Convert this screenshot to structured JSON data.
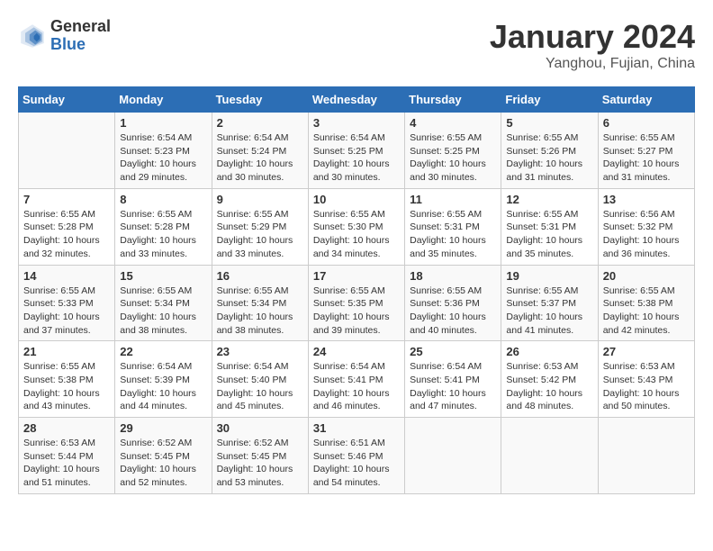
{
  "header": {
    "logo_line1": "General",
    "logo_line2": "Blue",
    "month_title": "January 2024",
    "location": "Yanghou, Fujian, China"
  },
  "calendar": {
    "days_of_week": [
      "Sunday",
      "Monday",
      "Tuesday",
      "Wednesday",
      "Thursday",
      "Friday",
      "Saturday"
    ],
    "weeks": [
      [
        {
          "day": "",
          "info": ""
        },
        {
          "day": "1",
          "info": "Sunrise: 6:54 AM\nSunset: 5:23 PM\nDaylight: 10 hours\nand 29 minutes."
        },
        {
          "day": "2",
          "info": "Sunrise: 6:54 AM\nSunset: 5:24 PM\nDaylight: 10 hours\nand 30 minutes."
        },
        {
          "day": "3",
          "info": "Sunrise: 6:54 AM\nSunset: 5:25 PM\nDaylight: 10 hours\nand 30 minutes."
        },
        {
          "day": "4",
          "info": "Sunrise: 6:55 AM\nSunset: 5:25 PM\nDaylight: 10 hours\nand 30 minutes."
        },
        {
          "day": "5",
          "info": "Sunrise: 6:55 AM\nSunset: 5:26 PM\nDaylight: 10 hours\nand 31 minutes."
        },
        {
          "day": "6",
          "info": "Sunrise: 6:55 AM\nSunset: 5:27 PM\nDaylight: 10 hours\nand 31 minutes."
        }
      ],
      [
        {
          "day": "7",
          "info": "Sunrise: 6:55 AM\nSunset: 5:28 PM\nDaylight: 10 hours\nand 32 minutes."
        },
        {
          "day": "8",
          "info": "Sunrise: 6:55 AM\nSunset: 5:28 PM\nDaylight: 10 hours\nand 33 minutes."
        },
        {
          "day": "9",
          "info": "Sunrise: 6:55 AM\nSunset: 5:29 PM\nDaylight: 10 hours\nand 33 minutes."
        },
        {
          "day": "10",
          "info": "Sunrise: 6:55 AM\nSunset: 5:30 PM\nDaylight: 10 hours\nand 34 minutes."
        },
        {
          "day": "11",
          "info": "Sunrise: 6:55 AM\nSunset: 5:31 PM\nDaylight: 10 hours\nand 35 minutes."
        },
        {
          "day": "12",
          "info": "Sunrise: 6:55 AM\nSunset: 5:31 PM\nDaylight: 10 hours\nand 35 minutes."
        },
        {
          "day": "13",
          "info": "Sunrise: 6:56 AM\nSunset: 5:32 PM\nDaylight: 10 hours\nand 36 minutes."
        }
      ],
      [
        {
          "day": "14",
          "info": "Sunrise: 6:55 AM\nSunset: 5:33 PM\nDaylight: 10 hours\nand 37 minutes."
        },
        {
          "day": "15",
          "info": "Sunrise: 6:55 AM\nSunset: 5:34 PM\nDaylight: 10 hours\nand 38 minutes."
        },
        {
          "day": "16",
          "info": "Sunrise: 6:55 AM\nSunset: 5:34 PM\nDaylight: 10 hours\nand 38 minutes."
        },
        {
          "day": "17",
          "info": "Sunrise: 6:55 AM\nSunset: 5:35 PM\nDaylight: 10 hours\nand 39 minutes."
        },
        {
          "day": "18",
          "info": "Sunrise: 6:55 AM\nSunset: 5:36 PM\nDaylight: 10 hours\nand 40 minutes."
        },
        {
          "day": "19",
          "info": "Sunrise: 6:55 AM\nSunset: 5:37 PM\nDaylight: 10 hours\nand 41 minutes."
        },
        {
          "day": "20",
          "info": "Sunrise: 6:55 AM\nSunset: 5:38 PM\nDaylight: 10 hours\nand 42 minutes."
        }
      ],
      [
        {
          "day": "21",
          "info": "Sunrise: 6:55 AM\nSunset: 5:38 PM\nDaylight: 10 hours\nand 43 minutes."
        },
        {
          "day": "22",
          "info": "Sunrise: 6:54 AM\nSunset: 5:39 PM\nDaylight: 10 hours\nand 44 minutes."
        },
        {
          "day": "23",
          "info": "Sunrise: 6:54 AM\nSunset: 5:40 PM\nDaylight: 10 hours\nand 45 minutes."
        },
        {
          "day": "24",
          "info": "Sunrise: 6:54 AM\nSunset: 5:41 PM\nDaylight: 10 hours\nand 46 minutes."
        },
        {
          "day": "25",
          "info": "Sunrise: 6:54 AM\nSunset: 5:41 PM\nDaylight: 10 hours\nand 47 minutes."
        },
        {
          "day": "26",
          "info": "Sunrise: 6:53 AM\nSunset: 5:42 PM\nDaylight: 10 hours\nand 48 minutes."
        },
        {
          "day": "27",
          "info": "Sunrise: 6:53 AM\nSunset: 5:43 PM\nDaylight: 10 hours\nand 50 minutes."
        }
      ],
      [
        {
          "day": "28",
          "info": "Sunrise: 6:53 AM\nSunset: 5:44 PM\nDaylight: 10 hours\nand 51 minutes."
        },
        {
          "day": "29",
          "info": "Sunrise: 6:52 AM\nSunset: 5:45 PM\nDaylight: 10 hours\nand 52 minutes."
        },
        {
          "day": "30",
          "info": "Sunrise: 6:52 AM\nSunset: 5:45 PM\nDaylight: 10 hours\nand 53 minutes."
        },
        {
          "day": "31",
          "info": "Sunrise: 6:51 AM\nSunset: 5:46 PM\nDaylight: 10 hours\nand 54 minutes."
        },
        {
          "day": "",
          "info": ""
        },
        {
          "day": "",
          "info": ""
        },
        {
          "day": "",
          "info": ""
        }
      ]
    ]
  }
}
